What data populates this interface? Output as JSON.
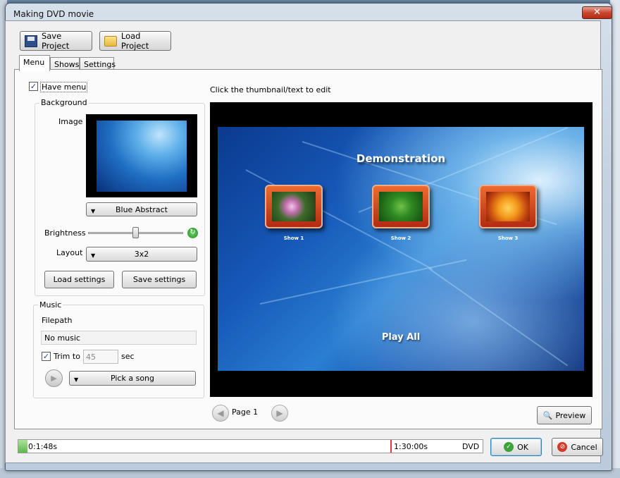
{
  "window": {
    "title": "Making DVD movie"
  },
  "toolbar": {
    "save_project": "Save Project",
    "load_project": "Load Project"
  },
  "tabs": [
    {
      "label": "Menu",
      "active": true
    },
    {
      "label": "Shows",
      "active": false
    },
    {
      "label": "Settings",
      "active": false
    }
  ],
  "menu_tab": {
    "have_menu_label": "Have menu",
    "have_menu_checked": true,
    "background": {
      "group_label": "Background",
      "image_label": "Image",
      "image_selected": "Blue Abstract",
      "brightness_label": "Brightness",
      "brightness_level": 0.5,
      "layout_label": "Layout",
      "layout_selected": "3x2",
      "load_settings": "Load settings",
      "save_settings": "Save settings"
    },
    "music": {
      "group_label": "Music",
      "filepath_label": "Filepath",
      "filepath_value": "No music",
      "trim_label": "Trim to",
      "trim_checked": true,
      "trim_value": "45",
      "trim_unit": "sec",
      "pick_song": "Pick a song"
    },
    "instruction": "Click the thumbnail/text to edit",
    "preview_menu": {
      "title": "Demonstration",
      "shows": [
        "Show 1",
        "Show 2",
        "Show 3"
      ],
      "play_all": "Play All"
    },
    "page_label": "Page 1",
    "preview_button": "Preview"
  },
  "status_bar": {
    "elapsed": "0:1:48s",
    "limit": "1:30:00s",
    "format": "DVD",
    "usage_fraction": 0.02
  },
  "buttons": {
    "ok": "OK",
    "cancel": "Cancel"
  }
}
